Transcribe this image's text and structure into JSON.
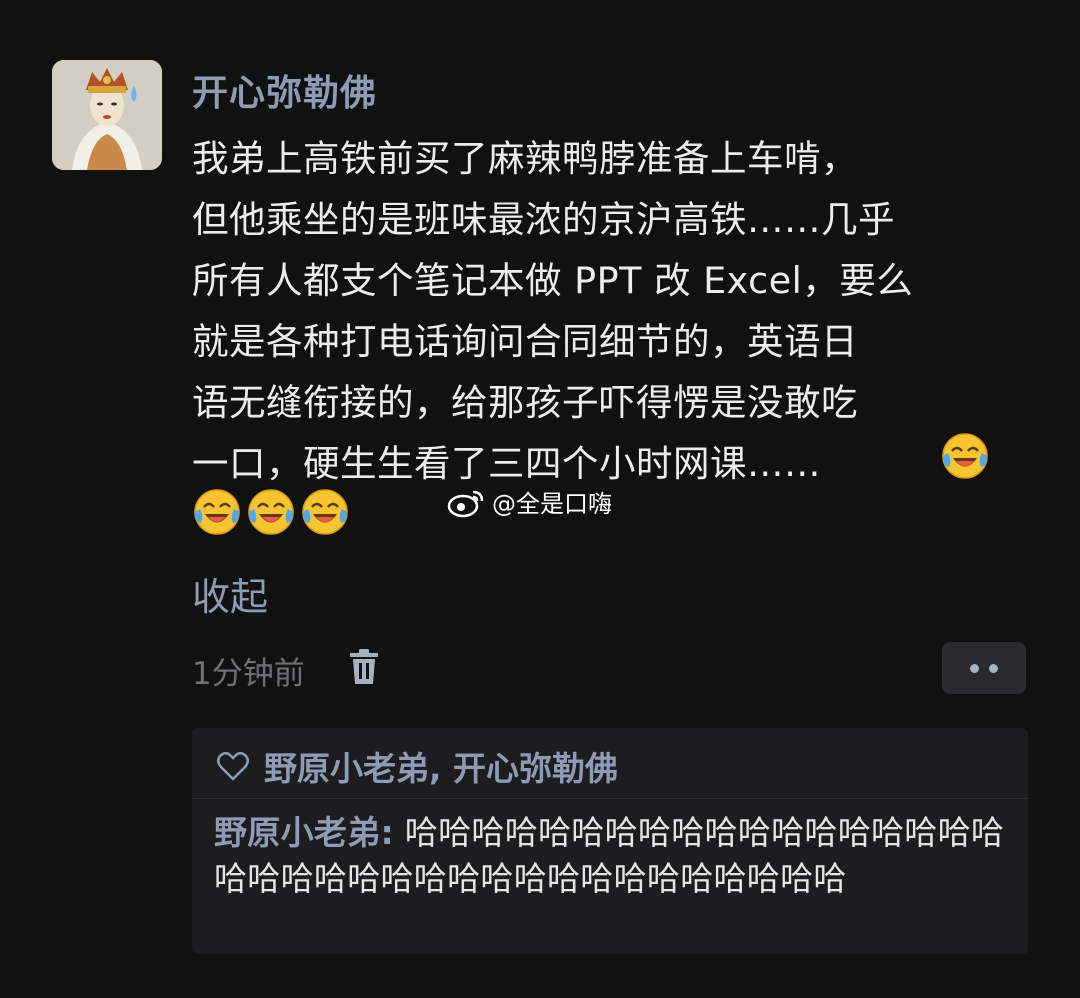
{
  "post": {
    "username": "开心弥勒佛",
    "content": "我弟上高铁前买了麻辣鸭脖准备上车啃，\n但他乘坐的是班味最浓的京沪高铁……几乎\n所有人都支个笔记本做 PPT 改 Excel，要么\n就是各种打电话询问合同细节的，英语日\n语无缝衔接的，给那孩子吓得愣是没敢吃\n一口，硬生生看了三四个小时网课……",
    "emojis": [
      "laughing-crying-emoji",
      "laughing-crying-emoji",
      "laughing-crying-emoji",
      "laughing-crying-emoji"
    ],
    "collapse_label": "收起",
    "time": "1分钟前"
  },
  "watermark": {
    "text": "@全是口嗨",
    "icon": "weibo-icon"
  },
  "likes": {
    "names": "野原小老弟, 开心弥勒佛",
    "icon": "heart-icon"
  },
  "reply": {
    "author": "野原小老弟:",
    "text": "哈哈哈哈哈哈哈哈哈哈哈哈哈哈哈哈哈哈哈哈哈哈哈哈哈哈哈哈哈哈哈哈哈哈哈哈哈"
  },
  "colors": {
    "background": "#111111",
    "accent": "#8d9bb4",
    "text": "#ececec",
    "muted": "#6f6f74"
  }
}
